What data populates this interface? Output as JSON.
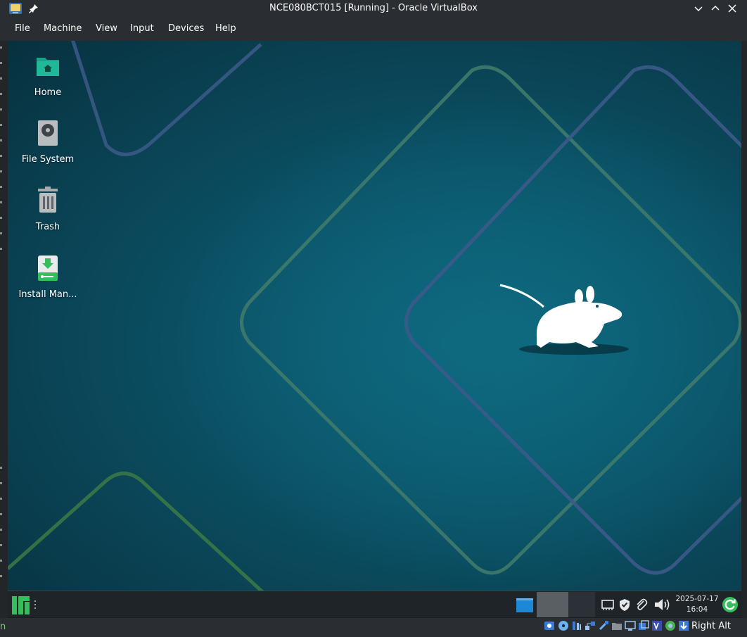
{
  "window": {
    "title": "NCE080BCT015 [Running] - Oracle VirtualBox"
  },
  "menu": [
    "File",
    "Machine",
    "View",
    "Input",
    "Devices",
    "Help"
  ],
  "desktop_icons": [
    {
      "label": "Home",
      "icon": "folder-home-icon"
    },
    {
      "label": "File System",
      "icon": "hard-drive-icon"
    },
    {
      "label": "Trash",
      "icon": "trash-icon"
    },
    {
      "label": "Install Man...",
      "icon": "installer-icon"
    }
  ],
  "taskbar": {
    "clock_date": "2025-07-17",
    "clock_time": "16:04",
    "tray_icons": [
      "network-icon",
      "shield-icon",
      "paperclip-icon",
      "volume-icon"
    ],
    "update_icon": "update-icon"
  },
  "statusbar": {
    "host_key": "Right Alt",
    "icons": [
      "hard-disk-icon",
      "optical-drive-icon",
      "audio-icon",
      "network-icon",
      "usb-icon",
      "shared-folders-icon",
      "display-icon",
      "recording-icon",
      "vt-x-icon",
      "mouse-integration-icon",
      "keyboard-capture-icon"
    ]
  },
  "host_fragment": "n",
  "colors": {
    "titlebar": "#2a2e32",
    "desktop_bg": "#0b5165",
    "taskbar": "#1e2428",
    "manjaro_green": "#35bf5c",
    "line_green": "#3f7a6b",
    "line_blue": "#3c5a8a"
  }
}
